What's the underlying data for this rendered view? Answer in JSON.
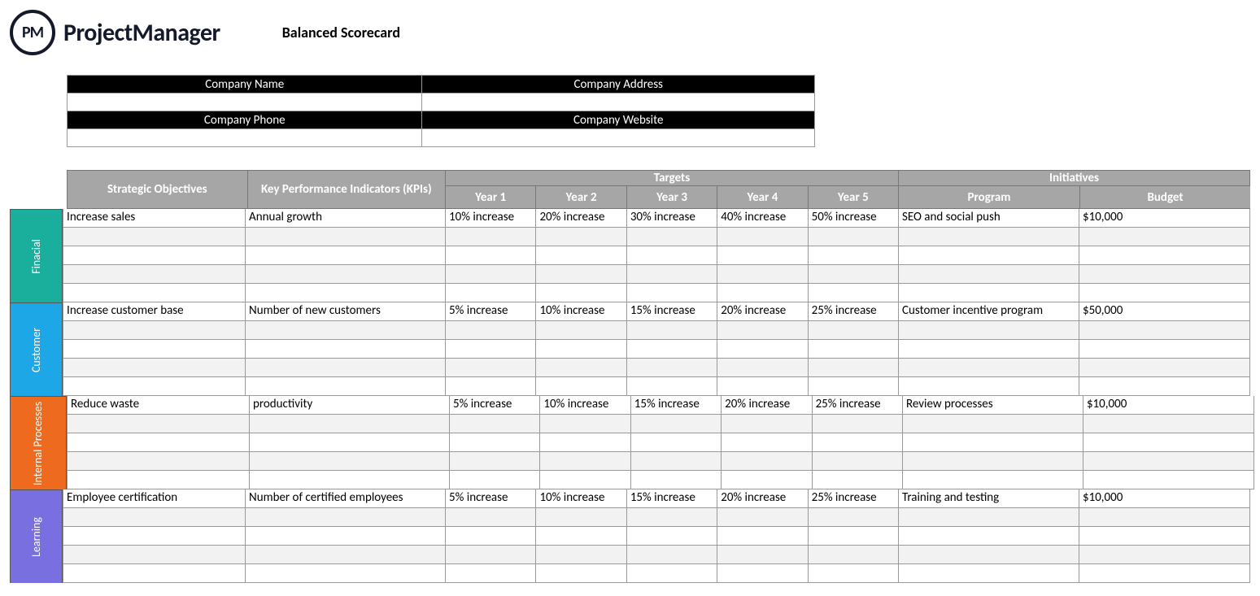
{
  "logo": {
    "badge": "PM",
    "brand": "ProjectManager"
  },
  "title": "Balanced Scorecard",
  "info": {
    "name_label": "Company Name",
    "address_label": "Company Address",
    "phone_label": "Company Phone",
    "website_label": "Company Website",
    "name_value": "",
    "address_value": "",
    "phone_value": "",
    "website_value": ""
  },
  "headers": {
    "objectives": "Strategic Objectives",
    "kpis": "Key Performance Indicators (KPIs)",
    "targets": "Targets",
    "initiatives": "Initiatives",
    "year1": "Year 1",
    "year2": "Year 2",
    "year3": "Year 3",
    "year4": "Year 4",
    "year5": "Year 5",
    "program": "Program",
    "budget": "Budget"
  },
  "sections": [
    {
      "label": "Finacial",
      "colorClass": "side-financial",
      "rows": [
        {
          "objective": "Increase sales",
          "kpi": "Annual growth",
          "y1": "10% increase",
          "y2": "20% increase",
          "y3": "30% increase",
          "y4": "40% increase",
          "y5": "50% increase",
          "program": "SEO and social push",
          "budget": "$10,000"
        },
        {
          "objective": "",
          "kpi": "",
          "y1": "",
          "y2": "",
          "y3": "",
          "y4": "",
          "y5": "",
          "program": "",
          "budget": ""
        },
        {
          "objective": "",
          "kpi": "",
          "y1": "",
          "y2": "",
          "y3": "",
          "y4": "",
          "y5": "",
          "program": "",
          "budget": ""
        },
        {
          "objective": "",
          "kpi": "",
          "y1": "",
          "y2": "",
          "y3": "",
          "y4": "",
          "y5": "",
          "program": "",
          "budget": ""
        },
        {
          "objective": "",
          "kpi": "",
          "y1": "",
          "y2": "",
          "y3": "",
          "y4": "",
          "y5": "",
          "program": "",
          "budget": ""
        }
      ]
    },
    {
      "label": "Customer",
      "colorClass": "side-customer",
      "rows": [
        {
          "objective": "Increase customer base",
          "kpi": "Number of new customers",
          "y1": "5% increase",
          "y2": "10% increase",
          "y3": "15% increase",
          "y4": "20% increase",
          "y5": "25% increase",
          "program": "Customer incentive program",
          "budget": "$50,000"
        },
        {
          "objective": "",
          "kpi": "",
          "y1": "",
          "y2": "",
          "y3": "",
          "y4": "",
          "y5": "",
          "program": "",
          "budget": ""
        },
        {
          "objective": "",
          "kpi": "",
          "y1": "",
          "y2": "",
          "y3": "",
          "y4": "",
          "y5": "",
          "program": "",
          "budget": ""
        },
        {
          "objective": "",
          "kpi": "",
          "y1": "",
          "y2": "",
          "y3": "",
          "y4": "",
          "y5": "",
          "program": "",
          "budget": ""
        },
        {
          "objective": "",
          "kpi": "",
          "y1": "",
          "y2": "",
          "y3": "",
          "y4": "",
          "y5": "",
          "program": "",
          "budget": ""
        }
      ]
    },
    {
      "label": "Internal Processes",
      "colorClass": "side-internal",
      "rows": [
        {
          "objective": "Reduce waste",
          "kpi": "productivity",
          "y1": "5% increase",
          "y2": "10% increase",
          "y3": "15% increase",
          "y4": "20% increase",
          "y5": "25% increase",
          "program": "Review processes",
          "budget": "$10,000"
        },
        {
          "objective": "",
          "kpi": "",
          "y1": "",
          "y2": "",
          "y3": "",
          "y4": "",
          "y5": "",
          "program": "",
          "budget": ""
        },
        {
          "objective": "",
          "kpi": "",
          "y1": "",
          "y2": "",
          "y3": "",
          "y4": "",
          "y5": "",
          "program": "",
          "budget": ""
        },
        {
          "objective": "",
          "kpi": "",
          "y1": "",
          "y2": "",
          "y3": "",
          "y4": "",
          "y5": "",
          "program": "",
          "budget": ""
        },
        {
          "objective": "",
          "kpi": "",
          "y1": "",
          "y2": "",
          "y3": "",
          "y4": "",
          "y5": "",
          "program": "",
          "budget": ""
        }
      ]
    },
    {
      "label": "Learning",
      "colorClass": "side-learning",
      "rows": [
        {
          "objective": "Employee certification",
          "kpi": "Number of certified employees",
          "y1": "5% increase",
          "y2": "10% increase",
          "y3": "15% increase",
          "y4": "20% increase",
          "y5": "25% increase",
          "program": "Training and testing",
          "budget": "$10,000"
        },
        {
          "objective": "",
          "kpi": "",
          "y1": "",
          "y2": "",
          "y3": "",
          "y4": "",
          "y5": "",
          "program": "",
          "budget": ""
        },
        {
          "objective": "",
          "kpi": "",
          "y1": "",
          "y2": "",
          "y3": "",
          "y4": "",
          "y5": "",
          "program": "",
          "budget": ""
        },
        {
          "objective": "",
          "kpi": "",
          "y1": "",
          "y2": "",
          "y3": "",
          "y4": "",
          "y5": "",
          "program": "",
          "budget": ""
        },
        {
          "objective": "",
          "kpi": "",
          "y1": "",
          "y2": "",
          "y3": "",
          "y4": "",
          "y5": "",
          "program": "",
          "budget": ""
        }
      ]
    }
  ]
}
